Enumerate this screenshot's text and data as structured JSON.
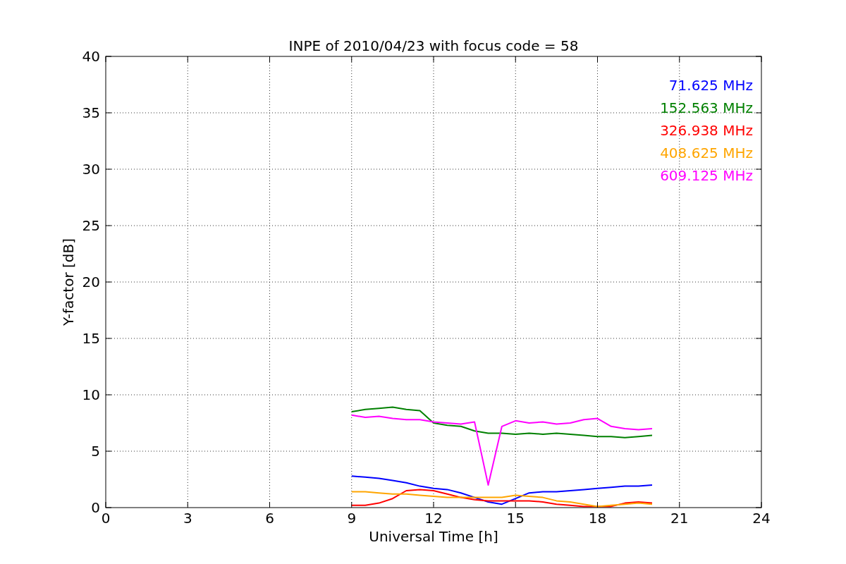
{
  "chart_data": {
    "type": "line",
    "title": "INPE of 2010/04/23 with focus code = 58",
    "xlabel": "Universal Time [h]",
    "ylabel": "Y-factor [dB]",
    "x": [
      9,
      9.5,
      10,
      10.5,
      11,
      11.5,
      12,
      12.5,
      13,
      13.5,
      14,
      14.5,
      15,
      15.5,
      16,
      16.5,
      17,
      17.5,
      18,
      18.5,
      19,
      19.5,
      20
    ],
    "series": [
      {
        "name": "71.625 MHz",
        "color": "#0000ff",
        "values": [
          2.8,
          2.7,
          2.6,
          2.4,
          2.2,
          1.9,
          1.7,
          1.6,
          1.3,
          0.9,
          0.5,
          0.3,
          0.8,
          1.3,
          1.4,
          1.4,
          1.5,
          1.6,
          1.7,
          1.8,
          1.9,
          1.9,
          2.0
        ]
      },
      {
        "name": "152.563 MHz",
        "color": "#008000",
        "values": [
          8.5,
          8.7,
          8.8,
          8.9,
          8.7,
          8.6,
          7.5,
          7.3,
          7.2,
          6.8,
          6.6,
          6.6,
          6.5,
          6.6,
          6.5,
          6.6,
          6.5,
          6.4,
          6.3,
          6.3,
          6.2,
          6.3,
          6.4
        ]
      },
      {
        "name": "326.938 MHz",
        "color": "#ff0000",
        "values": [
          0.2,
          0.2,
          0.4,
          0.8,
          1.5,
          1.6,
          1.5,
          1.2,
          0.9,
          0.7,
          0.6,
          0.6,
          0.6,
          0.6,
          0.5,
          0.3,
          0.2,
          0.1,
          0.1,
          0.1,
          0.4,
          0.5,
          0.4
        ]
      },
      {
        "name": "408.625 MHz",
        "color": "#ffa500",
        "values": [
          1.4,
          1.4,
          1.3,
          1.2,
          1.2,
          1.1,
          1.0,
          0.9,
          0.9,
          0.9,
          0.9,
          0.9,
          1.1,
          1.0,
          0.9,
          0.6,
          0.5,
          0.3,
          0.1,
          0.2,
          0.3,
          0.4,
          0.3
        ]
      },
      {
        "name": "609.125 MHz",
        "color": "#ff00ff",
        "values": [
          8.2,
          8.0,
          8.1,
          7.9,
          7.8,
          7.8,
          7.6,
          7.5,
          7.4,
          7.6,
          2.0,
          7.2,
          7.7,
          7.5,
          7.6,
          7.4,
          7.5,
          7.8,
          7.9,
          7.2,
          7.0,
          6.9,
          7.0
        ]
      }
    ],
    "grid": true,
    "xlim": [
      0,
      24
    ],
    "ylim": [
      0,
      40
    ],
    "xticks": [
      0,
      3,
      6,
      9,
      12,
      15,
      18,
      21,
      24
    ],
    "yticks": [
      0,
      5,
      10,
      15,
      20,
      25,
      30,
      35,
      40
    ]
  }
}
